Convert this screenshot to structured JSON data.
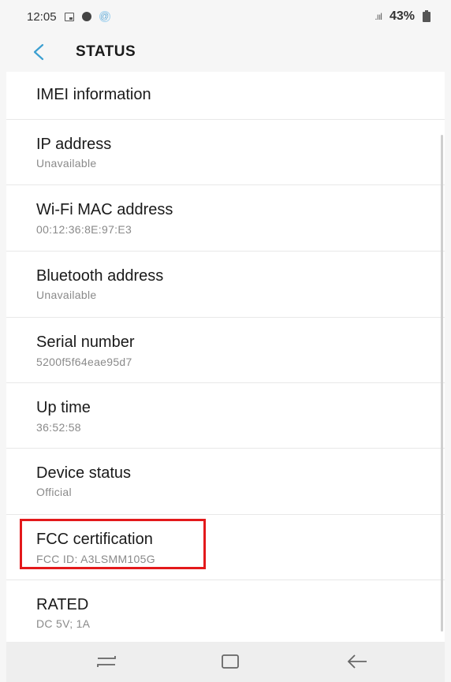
{
  "statusbar": {
    "time": "12:05",
    "signal": ".ııl",
    "battery": "43%",
    "icons": [
      "gallery-icon",
      "dot-icon",
      "at-icon",
      "signal-icon",
      "battery-icon"
    ]
  },
  "appbar": {
    "title": "STATUS",
    "back_icon": "chevron-left-icon"
  },
  "items": [
    {
      "label": "IMEI information",
      "value": ""
    },
    {
      "label": "IP address",
      "value": "Unavailable"
    },
    {
      "label": "Wi-Fi MAC address",
      "value": "00:12:36:8E:97:E3"
    },
    {
      "label": "Bluetooth address",
      "value": "Unavailable"
    },
    {
      "label": "Serial number",
      "value": "5200f5f64eae95d7"
    },
    {
      "label": "Up time",
      "value": "36:52:58"
    },
    {
      "label": "Device status",
      "value": "Official"
    },
    {
      "label": "FCC certification",
      "value": "FCC ID: A3LSMM105G"
    },
    {
      "label": "RATED",
      "value": "DC 5V; 1A"
    }
  ],
  "navbar": {
    "buttons": [
      "recents-icon",
      "home-icon",
      "back-arrow-icon"
    ]
  },
  "colors": {
    "accent": "#3b9fd1",
    "highlight": "#e3191b"
  }
}
